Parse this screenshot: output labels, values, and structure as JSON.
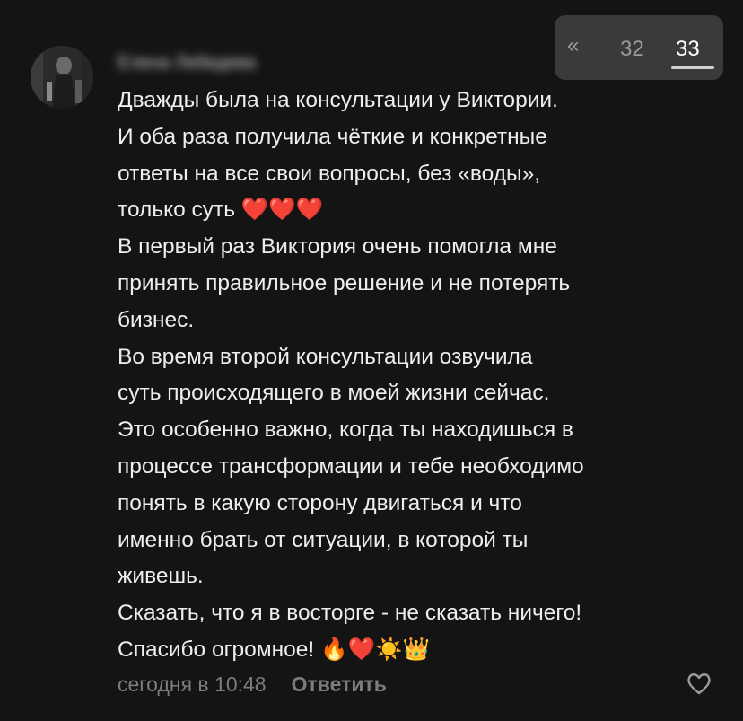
{
  "comment": {
    "author_name": "Елена Лебедева",
    "body": "Дважды была на консультации у Виктории.\nИ оба раза получила чёткие и конкретные\nответы на все свои вопросы, без «воды»,\nтолько суть ❤️❤️❤️\nВ первый раз Виктория очень помогла мне\nпринять правильное решение и не потерять\nбизнес.\nВо время второй консультации озвучила\nсуть происходящего в моей жизни сейчас.\nЭто особенно важно, когда ты находишься в\nпроцессе трансформации и тебе необходимо\nпонять в какую сторону двигаться и что\nименно брать от ситуации, в которой ты\nживешь.\nСказать, что я в восторге - не сказать ничего!\nСпасибо огромное! 🔥❤️☀️👑",
    "timestamp": "сегодня в 10:48",
    "reply_label": "Ответить"
  },
  "pager": {
    "prev_label": "«",
    "pages": [
      "32",
      "33"
    ],
    "current": "33"
  },
  "icons": {
    "avatar": "user-photo",
    "like": "heart-outline-icon"
  },
  "colors": {
    "background": "#141414",
    "text": "#eeeeee",
    "muted": "#7c7c7c",
    "pager_bg": "#3a3a3b"
  }
}
